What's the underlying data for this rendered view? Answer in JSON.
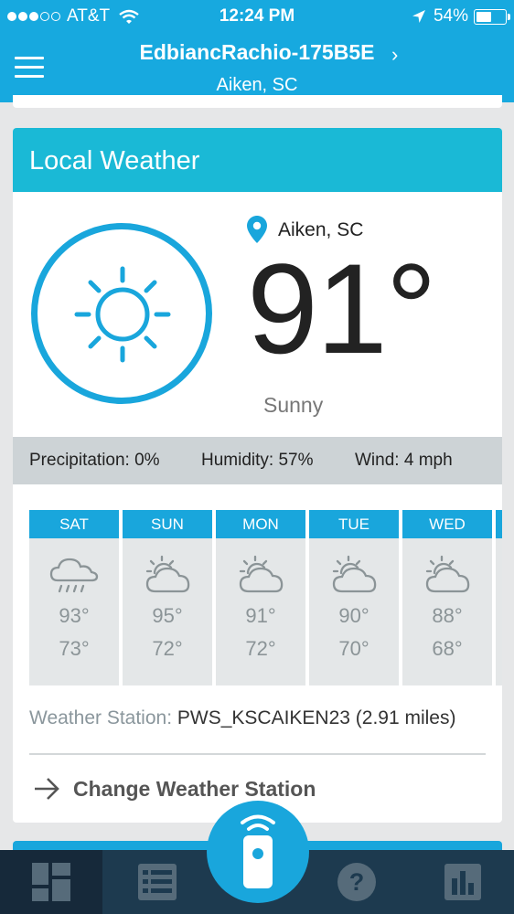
{
  "status_bar": {
    "carrier": "AT&T",
    "time": "12:24 PM",
    "battery": "54%",
    "battery_level": 0.54,
    "signal_bars": 3
  },
  "header": {
    "device_name": "EdbiancRachio-175B5E",
    "location": "Aiken, SC",
    "icons": [
      "menu-icon",
      "chevron-right-icon"
    ]
  },
  "weather": {
    "title": "Local Weather",
    "location": "Aiken, SC",
    "temperature": "91°",
    "condition": "Sunny",
    "condition_icon": "sun-icon",
    "precipitation": "Precipitation: 0%",
    "humidity": "Humidity: 57%",
    "wind": "Wind: 4 mph"
  },
  "forecast": [
    {
      "day": "SAT",
      "high": "93°",
      "low": "73°",
      "icon": "rain-icon"
    },
    {
      "day": "SUN",
      "high": "95°",
      "low": "72°",
      "icon": "partly-cloudy-icon"
    },
    {
      "day": "MON",
      "high": "91°",
      "low": "72°",
      "icon": "partly-cloudy-icon"
    },
    {
      "day": "TUE",
      "high": "90°",
      "low": "70°",
      "icon": "partly-cloudy-icon"
    },
    {
      "day": "WED",
      "high": "88°",
      "low": "68°",
      "icon": "partly-cloudy-icon"
    }
  ],
  "station": {
    "label": "Weather Station: ",
    "value": "PWS_KSCAIKEN23 (2.91 miles)"
  },
  "change_station": "Change Weather Station",
  "tabbar": {
    "tabs": [
      "dashboard-icon",
      "list-icon",
      "help-icon",
      "chart-icon"
    ],
    "center": "remote-icon"
  },
  "colors": {
    "header": "#17a9df",
    "card_header": "#1ab9d6",
    "accent": "#19a6dc",
    "tabbar": "#1d3a4f"
  }
}
